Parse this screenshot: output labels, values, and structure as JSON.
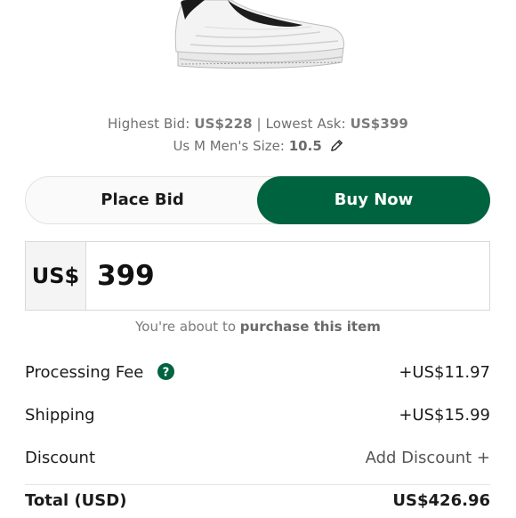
{
  "product": {
    "highest_bid_label": "Highest Bid:",
    "highest_bid_value": "US$228",
    "separator": "|",
    "lowest_ask_label": "Lowest Ask:",
    "lowest_ask_value": "US$399",
    "size_label": "Us M Men's Size:",
    "size_value": "10.5",
    "edit_icon": "pencil-icon"
  },
  "toggle": {
    "place_bid": "Place Bid",
    "buy_now": "Buy Now",
    "selected": "Buy Now",
    "accent_color": "#006340"
  },
  "price": {
    "currency": "US$",
    "amount": "399"
  },
  "purchase_note": {
    "prefix": "You're about to",
    "emphasis": "purchase this item"
  },
  "summary": {
    "processing_fee_label": "Processing Fee",
    "processing_fee_icon": "help-icon",
    "processing_fee_value": "+US$11.97",
    "shipping_label": "Shipping",
    "shipping_value": "+US$15.99",
    "discount_label": "Discount",
    "discount_action": "Add Discount +",
    "total_label": "Total (USD)",
    "total_value": "US$426.96"
  }
}
